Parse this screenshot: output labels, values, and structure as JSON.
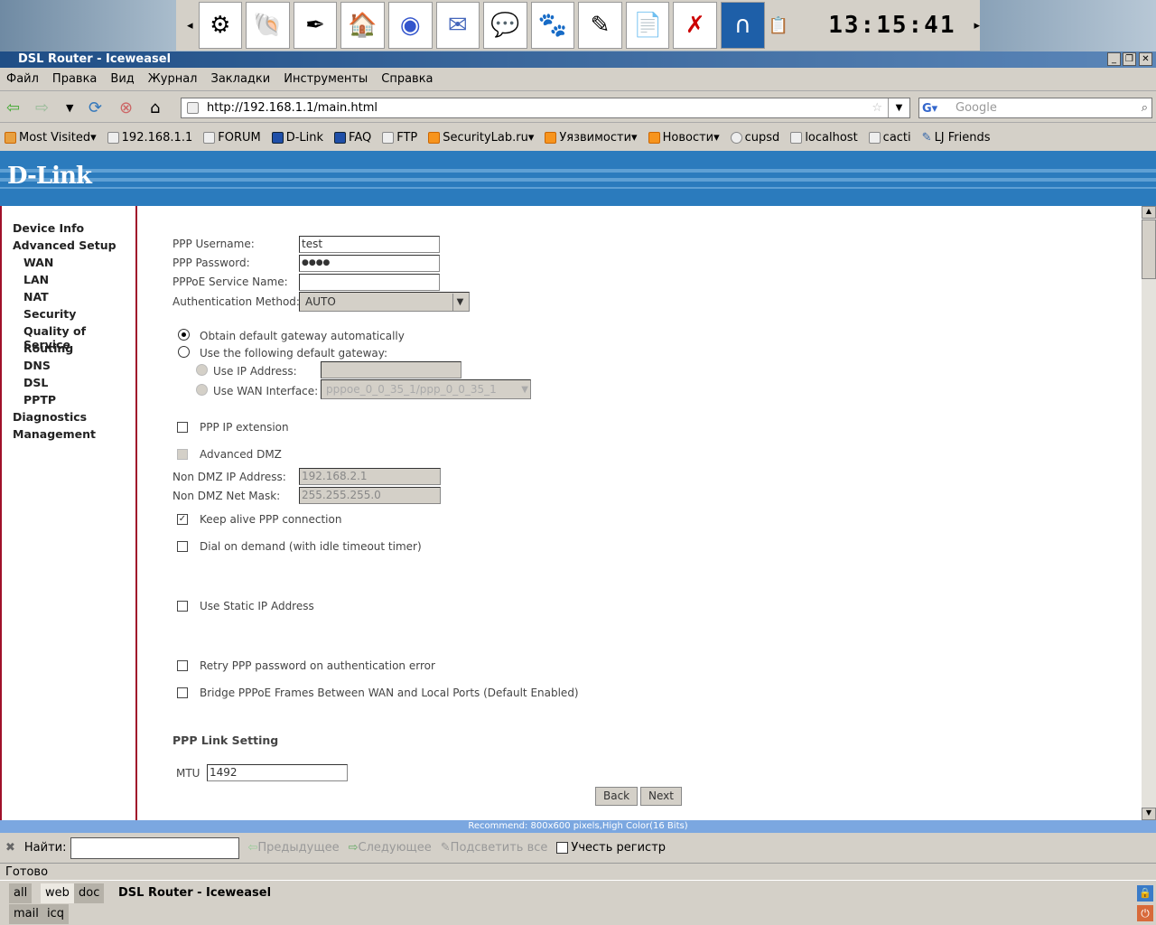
{
  "panel": {
    "clock": "13:15:41",
    "launchers": [
      "kde",
      "konsole",
      "editor",
      "home",
      "browser",
      "kmail",
      "pidgin",
      "gimp",
      "inkscape",
      "office",
      "pdf",
      "wireshark"
    ]
  },
  "window": {
    "title": "DSL Router - Iceweasel"
  },
  "menu": [
    "Файл",
    "Правка",
    "Вид",
    "Журнал",
    "Закладки",
    "Инструменты",
    "Справка"
  ],
  "nav": {
    "url": "http://192.168.1.1/main.html",
    "search_placeholder": "Google"
  },
  "bookmarks": [
    {
      "label": "Most Visited▾",
      "icon": "folder"
    },
    {
      "label": "192.168.1.1",
      "icon": "page"
    },
    {
      "label": "FORUM",
      "icon": "page"
    },
    {
      "label": "D-Link",
      "icon": "dlink"
    },
    {
      "label": "FAQ",
      "icon": "dlink"
    },
    {
      "label": "FTP",
      "icon": "page"
    },
    {
      "label": "SecurityLab.ru▾",
      "icon": "rss"
    },
    {
      "label": "Уязвимости▾",
      "icon": "rss"
    },
    {
      "label": "Новости▾",
      "icon": "rss"
    },
    {
      "label": "cupsd",
      "icon": "page"
    },
    {
      "label": "localhost",
      "icon": "page"
    },
    {
      "label": "cacti",
      "icon": "page"
    },
    {
      "label": "LJ Friends",
      "icon": "lj"
    }
  ],
  "brand": "D-Link",
  "sidebar": [
    "Device Info",
    "Advanced Setup",
    "WAN",
    "LAN",
    "NAT",
    "Security",
    "Quality of Service",
    "Routing",
    "DNS",
    "DSL",
    "PPTP",
    "Diagnostics",
    "Management"
  ],
  "form": {
    "username_label": "PPP Username:",
    "username": "test",
    "password_label": "PPP Password:",
    "password": "●●●●",
    "service_label": "PPPoE Service Name:",
    "service": "",
    "auth_label": "Authentication Method:",
    "auth": "AUTO",
    "gw_auto": "Obtain default gateway automatically",
    "gw_manual": "Use the following default gateway:",
    "use_ip": "Use IP Address:",
    "use_wan": "Use WAN Interface:",
    "wan_iface": "pppoe_0_0_35_1/ppp_0_0_35_1",
    "ppp_ip_ext": "PPP IP extension",
    "adv_dmz": "Advanced DMZ",
    "nondmz_ip_label": "Non DMZ IP Address:",
    "nondmz_ip": "192.168.2.1",
    "nondmz_mask_label": "Non DMZ Net Mask:",
    "nondmz_mask": "255.255.255.0",
    "keepalive": "Keep alive PPP connection",
    "dial_demand": "Dial on demand (with idle timeout timer)",
    "static_ip": "Use Static IP Address",
    "retry": "Retry PPP password on authentication error",
    "bridge": "Bridge PPPoE Frames Between WAN and Local Ports (Default Enabled)",
    "link_heading": "PPP Link Setting",
    "mtu_label": "MTU",
    "mtu": "1492",
    "back": "Back",
    "next": "Next"
  },
  "recommend": "Recommend: 800x600 pixels,High Color(16 Bits)",
  "find": {
    "label": "Найти:",
    "prev": "Предыдущее",
    "next": "Следующее",
    "highlight": "Подсветить все",
    "case": "Учесть регистр"
  },
  "status": "Готово",
  "taskbar": {
    "desktops": [
      "all",
      "web",
      "doc",
      "mail",
      "icq"
    ],
    "task": "DSL Router - Iceweasel"
  }
}
